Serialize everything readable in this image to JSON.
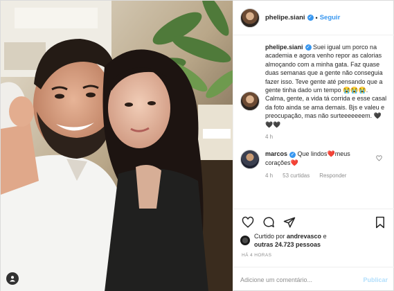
{
  "post": {
    "author": "phelipe.siani",
    "follow_label": "Seguir",
    "dot": "•",
    "verified": "✓"
  },
  "caption": {
    "user": "phelipe.siani",
    "text": " Suei igual um porco na academia e agora venho repor as calorias almoçando com a minha gata. Faz quase duas semanas que a gente não conseguia fazer isso. Teve gente até pensando que a gente tinha dado um tempo 😭😭😭. Calma, gente, a vida tá corrida e esse casal da foto ainda se ama demais. Bjs e valeu e preocupação, mas não surteeeeeeem. 🖤🖤🖤",
    "time": "4 h"
  },
  "reply": {
    "user": "marcos",
    "text": " Que lindos❤️meus corações❤️",
    "time": "4 h",
    "likes": "53 curtidas",
    "reply_label": "Responder"
  },
  "likes_block": {
    "prefix": "Curtido por ",
    "user": "andrevasco",
    "middle": " e",
    "others": "outras 24.723 pessoas"
  },
  "posted_time": "HÁ 4 HORAS",
  "comment_box": {
    "placeholder": "Adicione um comentário...",
    "publish_label": "Publicar"
  },
  "colors": {
    "link_blue": "#3897f0",
    "publish_disabled": "#b2dffc",
    "muted": "#8e8e8e"
  },
  "icons": [
    "heart-icon",
    "comment-icon",
    "share-icon",
    "bookmark-icon",
    "user-tag-icon"
  ]
}
